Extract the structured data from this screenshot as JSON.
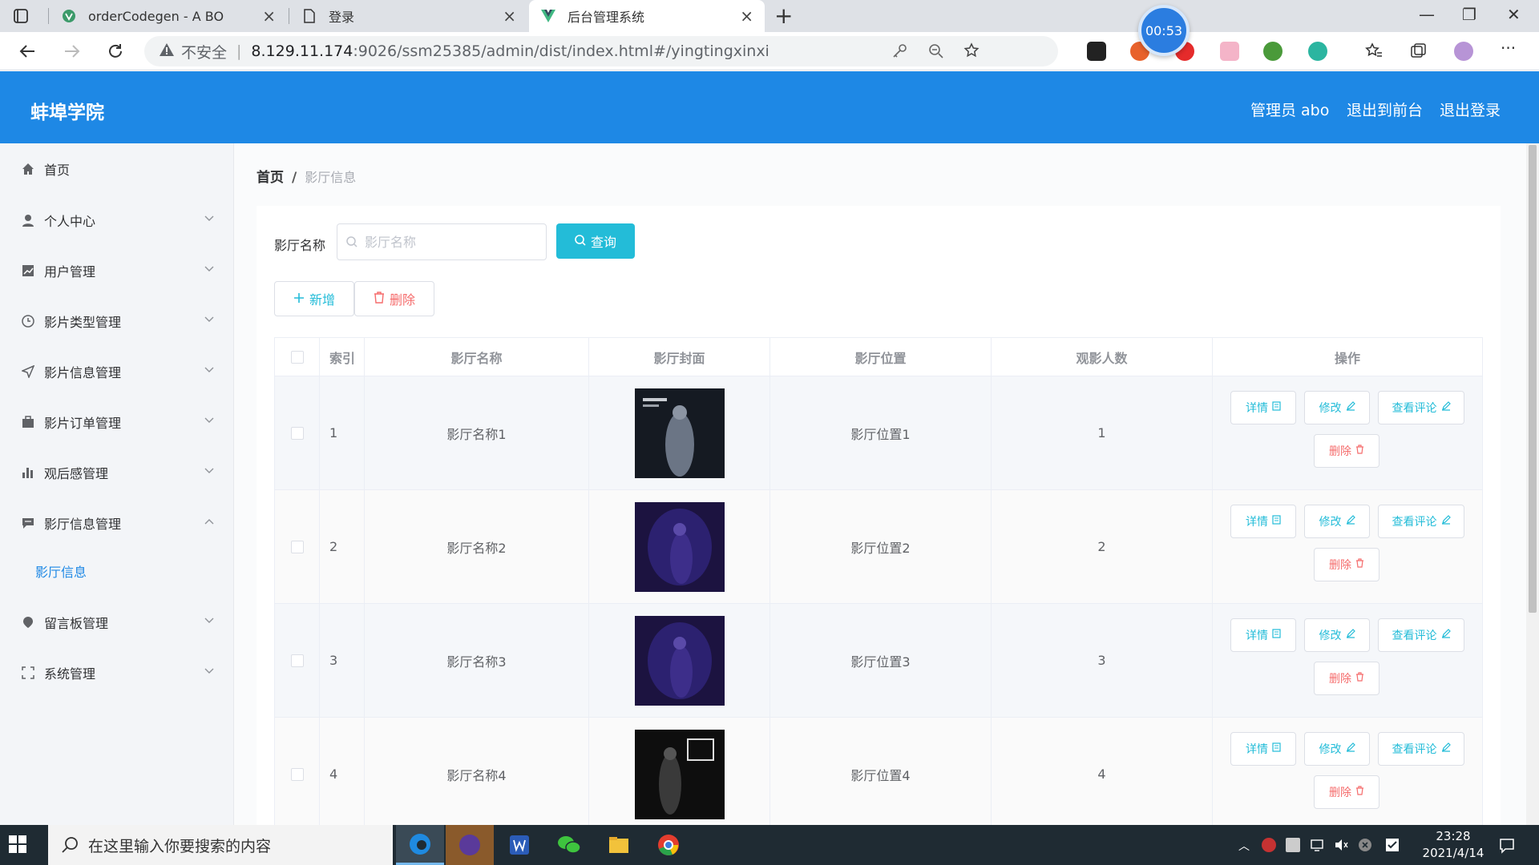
{
  "browser": {
    "tabs": [
      {
        "title": "orderCodegen - A BO"
      },
      {
        "title": "登录"
      },
      {
        "title": "后台管理系统"
      }
    ],
    "timer": "00:53",
    "address": {
      "insecure_label": "不安全",
      "host": "8.129.11.174",
      "path": ":9026/ssm25385/admin/dist/index.html#/yingtingxinxi"
    }
  },
  "header": {
    "brand": "蚌埠学院",
    "user_label": "管理员 abo",
    "front_label": "退出到前台",
    "logout_label": "退出登录"
  },
  "sidebar": {
    "items": [
      {
        "label": "首页",
        "icon": "home-icon"
      },
      {
        "label": "个人中心",
        "icon": "user-icon"
      },
      {
        "label": "用户管理",
        "icon": "chart-icon"
      },
      {
        "label": "影片类型管理",
        "icon": "clock-icon"
      },
      {
        "label": "影片信息管理",
        "icon": "send-icon"
      },
      {
        "label": "影片订单管理",
        "icon": "briefcase-icon"
      },
      {
        "label": "观后感管理",
        "icon": "bar-chart-icon"
      },
      {
        "label": "影厅信息管理",
        "icon": "chat-icon"
      },
      {
        "label": "留言板管理",
        "icon": "location-icon"
      },
      {
        "label": "系统管理",
        "icon": "fullscreen-icon"
      }
    ],
    "active_sub": "影厅信息"
  },
  "breadcrumb": {
    "home": "首页",
    "separator": "/",
    "current": "影厅信息"
  },
  "search": {
    "label": "影厅名称",
    "placeholder": "影厅名称",
    "button": "查询"
  },
  "toolbar": {
    "add_label": "新增",
    "delete_label": "删除"
  },
  "table": {
    "headers": {
      "index": "索引",
      "name": "影厅名称",
      "cover": "影厅封面",
      "position": "影厅位置",
      "count": "观影人数",
      "ops": "操作"
    },
    "rows": [
      {
        "index": "1",
        "name": "影厅名称1",
        "position": "影厅位置1",
        "count": "1"
      },
      {
        "index": "2",
        "name": "影厅名称2",
        "position": "影厅位置2",
        "count": "2"
      },
      {
        "index": "3",
        "name": "影厅名称3",
        "position": "影厅位置3",
        "count": "3"
      },
      {
        "index": "4",
        "name": "影厅名称4",
        "position": "影厅位置4",
        "count": "4"
      }
    ],
    "ops": {
      "detail": "详情",
      "edit": "修改",
      "review": "查看评论",
      "delete": "删除"
    }
  },
  "taskbar": {
    "search_placeholder": "在这里输入你要搜索的内容",
    "time": "23:28",
    "date": "2021/4/14"
  },
  "colors": {
    "header_blue": "#1e88e5",
    "accent_cyan": "#23bcd8",
    "danger_red": "#f56c6c"
  }
}
